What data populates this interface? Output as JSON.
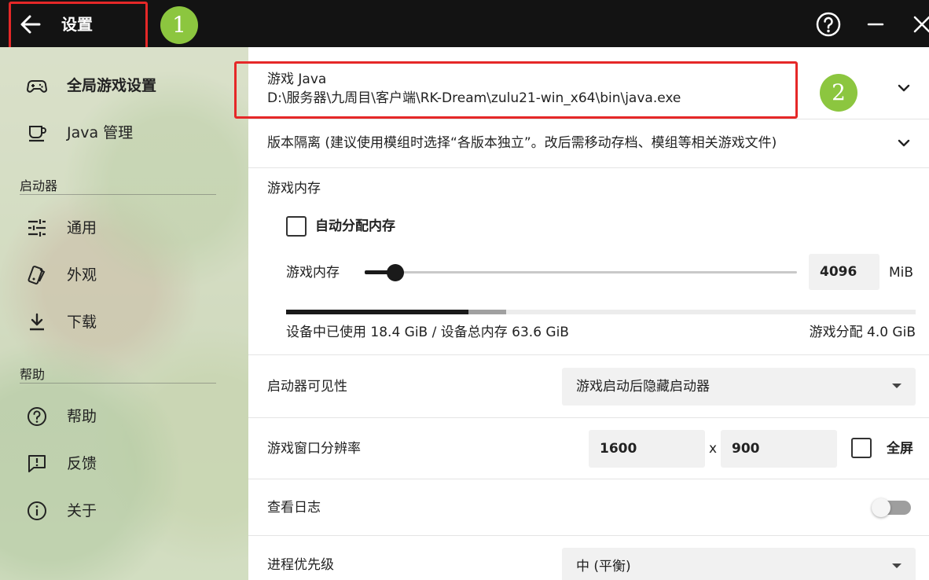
{
  "titlebar": {
    "title": "设置",
    "annotation_1": "1",
    "annotation_2": "2"
  },
  "sidebar": {
    "items_top": [
      {
        "label": "全局游戏设置",
        "icon": "gamepad-icon",
        "active": true
      },
      {
        "label": "Java 管理",
        "icon": "java-cup-icon",
        "active": false
      }
    ],
    "section_launcher": "启动器",
    "items_launcher": [
      {
        "label": "通用",
        "icon": "sliders-icon"
      },
      {
        "label": "外观",
        "icon": "palette-icon"
      },
      {
        "label": "下载",
        "icon": "download-icon"
      }
    ],
    "section_help": "帮助",
    "items_help": [
      {
        "label": "帮助",
        "icon": "help-icon"
      },
      {
        "label": "反馈",
        "icon": "feedback-icon"
      },
      {
        "label": "关于",
        "icon": "info-icon"
      }
    ]
  },
  "main": {
    "java": {
      "label": "游戏 Java",
      "path": "D:\\服务器\\九周目\\客户端\\RK-Dream\\zulu21-win_x64\\bin\\java.exe"
    },
    "isolation": {
      "label": "版本隔离 (建议使用模组时选择“各版本独立”。改后需移动存档、模组等相关游戏文件)"
    },
    "memory": {
      "section_label": "游戏内存",
      "auto_label": "自动分配内存",
      "slider_label": "游戏内存",
      "value": "4096",
      "unit": "MiB",
      "slider_fraction": 0.07,
      "used_fraction": 0.29,
      "alloc_fraction": 0.06,
      "usage_text": "设备中已使用 18.4 GiB / 设备总内存 63.6 GiB",
      "alloc_text": "游戏分配 4.0 GiB"
    },
    "visibility": {
      "label": "启动器可见性",
      "value": "游戏启动后隐藏启动器"
    },
    "resolution": {
      "label": "游戏窗口分辨率",
      "width": "1600",
      "separator": "x",
      "height": "900",
      "fullscreen_label": "全屏"
    },
    "logs": {
      "label": "查看日志",
      "enabled": false
    },
    "priority": {
      "label": "进程优先级",
      "value": "中 (平衡)"
    }
  },
  "colors": {
    "accent": "#1a1a1a",
    "annotation_red": "#e52828",
    "annotation_green": "#8cc63f"
  }
}
